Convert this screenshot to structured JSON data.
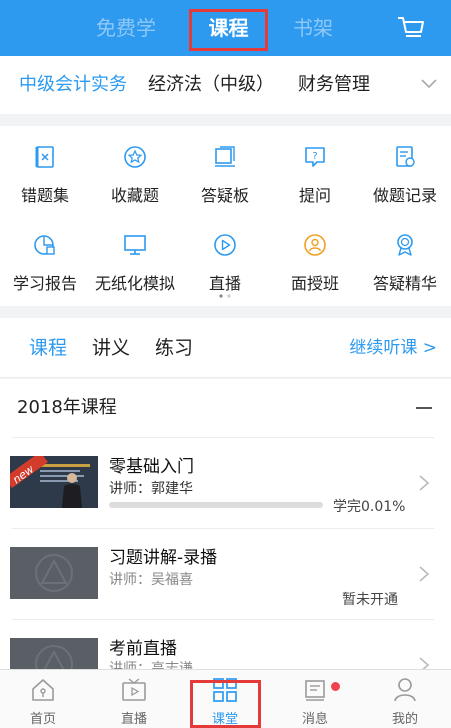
{
  "header": {
    "tabs": [
      {
        "label": "免费学"
      },
      {
        "label": "课程"
      },
      {
        "label": "书架"
      }
    ],
    "active_tab": "课程"
  },
  "subjects": [
    {
      "label": "中级会计实务"
    },
    {
      "label": "经济法（中级）"
    },
    {
      "label": "财务管理"
    }
  ],
  "tools": [
    {
      "label": "错题集",
      "icon": "wrong-book-icon"
    },
    {
      "label": "收藏题",
      "icon": "star-icon"
    },
    {
      "label": "答疑板",
      "icon": "board-icon"
    },
    {
      "label": "提问",
      "icon": "question-icon"
    },
    {
      "label": "做题记录",
      "icon": "record-icon"
    },
    {
      "label": "学习报告",
      "icon": "report-icon"
    },
    {
      "label": "无纸化模拟",
      "icon": "monitor-icon"
    },
    {
      "label": "直播",
      "icon": "play-icon"
    },
    {
      "label": "面授班",
      "icon": "person-icon"
    },
    {
      "label": "答疑精华",
      "icon": "badge-icon"
    }
  ],
  "course_tabs": [
    {
      "label": "课程"
    },
    {
      "label": "讲义"
    },
    {
      "label": "练习"
    }
  ],
  "continue_label": "继续听课 >",
  "year_group": "2018年课程",
  "courses": [
    {
      "title": "零基础入门",
      "teacher": "讲师：郭建华",
      "status": "学完0.01%",
      "progress": 0.0001
    },
    {
      "title": "习题讲解-录播",
      "teacher": "讲师：吴福喜",
      "status": "暂未开通"
    },
    {
      "title": "考前直播",
      "teacher": "讲师：高志谦"
    }
  ],
  "thumb_badge": "new",
  "bottom_nav": [
    {
      "label": "首页"
    },
    {
      "label": "直播"
    },
    {
      "label": "课堂"
    },
    {
      "label": "消息"
    },
    {
      "label": "我的"
    }
  ],
  "colors": {
    "accent": "#2d9af0",
    "highlight_box": "#e53a3a",
    "badge": "#f0434b"
  }
}
